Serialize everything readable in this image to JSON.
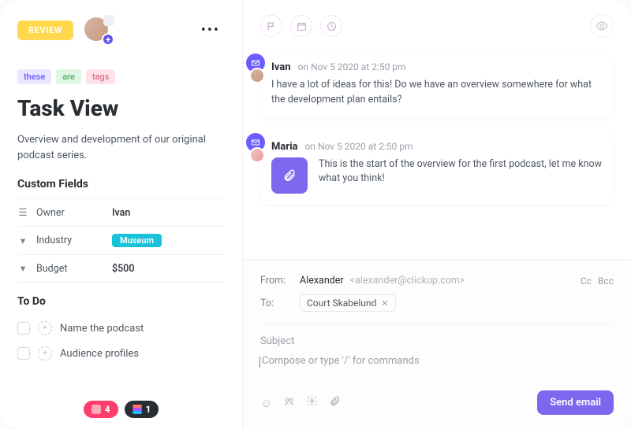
{
  "header": {
    "status": "REVIEW"
  },
  "tags": [
    {
      "label": "these",
      "cls": "tag-purple"
    },
    {
      "label": "are",
      "cls": "tag-green"
    },
    {
      "label": "tags",
      "cls": "tag-pink"
    }
  ],
  "task": {
    "title": "Task View",
    "subtitle": "Overview and development of our original podcast series."
  },
  "customFields": {
    "heading": "Custom Fields",
    "owner": {
      "label": "Owner",
      "value": "Ivan"
    },
    "industry": {
      "label": "Industry",
      "value": "Museum"
    },
    "budget": {
      "label": "Budget",
      "value": "$500"
    }
  },
  "todo": {
    "heading": "To Do",
    "items": [
      {
        "label": "Name the podcast"
      },
      {
        "label": "Audience profiles"
      }
    ]
  },
  "bottomChips": {
    "pinkCount": "4",
    "darkCount": "1"
  },
  "comments": [
    {
      "author": "Ivan",
      "timestamp": "on Nov 5 2020 at 2:50 pm",
      "body": "I have a lot of ideas for this! Do we have an overview somewhere for what the development plan entails?"
    },
    {
      "author": "Maria",
      "timestamp": "on Nov 5 2020 at 2:50 pm",
      "body": "This is the start of the overview for the first podcast, let me know what you think!"
    }
  ],
  "composer": {
    "fromLabel": "From:",
    "fromName": "Alexander",
    "fromEmail": "<alexander@clickup.com>",
    "cc": "Cc",
    "bcc": "Bcc",
    "toLabel": "To:",
    "recipient": "Court Skabelund",
    "subjectPlaceholder": "Subject",
    "bodyPlaceholder": "Compose or type '/' for commands",
    "sendLabel": "Send email"
  }
}
